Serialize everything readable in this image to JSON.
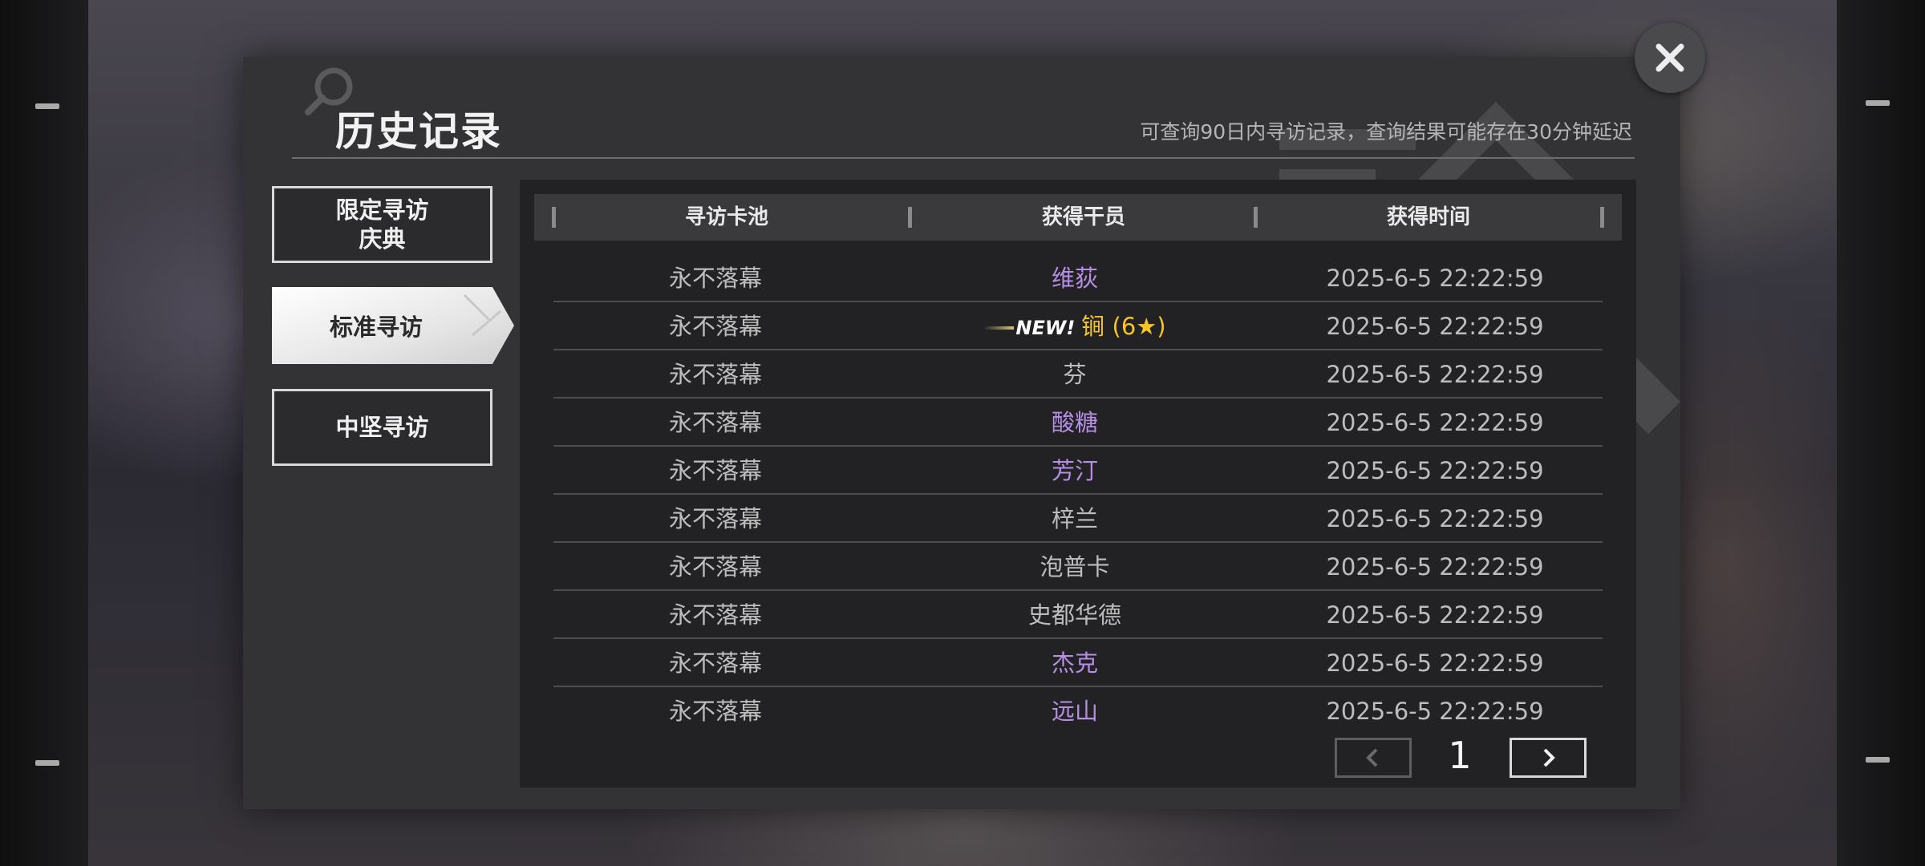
{
  "dialog": {
    "title": "历史记录",
    "subtitle": "可查询90日内寻访记录，查询结果可能存在30分钟延迟"
  },
  "tabs": [
    {
      "line1": "限定寻访",
      "line2": "庆典",
      "active": false
    },
    {
      "label": "标准寻访",
      "active": true
    },
    {
      "label": "中坚寻访",
      "active": false
    }
  ],
  "table": {
    "headers": [
      "寻访卡池",
      "获得干员",
      "获得时间"
    ],
    "rows": [
      {
        "pool": "永不落幕",
        "operator": "维荻",
        "time": "2025-6-5 22:22:59",
        "rarity_color": "#b78ee6"
      },
      {
        "pool": "永不落幕",
        "badge": "NEW!",
        "operator": "锏 (6★)",
        "time": "2025-6-5 22:22:59",
        "rarity_color": "#f5c526"
      },
      {
        "pool": "永不落幕",
        "operator": "芬",
        "time": "2025-6-5 22:22:59",
        "rarity_color": "#bdbdbd"
      },
      {
        "pool": "永不落幕",
        "operator": "酸糖",
        "time": "2025-6-5 22:22:59",
        "rarity_color": "#b78ee6"
      },
      {
        "pool": "永不落幕",
        "operator": "芳汀",
        "time": "2025-6-5 22:22:59",
        "rarity_color": "#b78ee6"
      },
      {
        "pool": "永不落幕",
        "operator": "梓兰",
        "time": "2025-6-5 22:22:59",
        "rarity_color": "#bdbdbd"
      },
      {
        "pool": "永不落幕",
        "operator": "泡普卡",
        "time": "2025-6-5 22:22:59",
        "rarity_color": "#bdbdbd"
      },
      {
        "pool": "永不落幕",
        "operator": "史都华德",
        "time": "2025-6-5 22:22:59",
        "rarity_color": "#bdbdbd"
      },
      {
        "pool": "永不落幕",
        "operator": "杰克",
        "time": "2025-6-5 22:22:59",
        "rarity_color": "#b78ee6"
      },
      {
        "pool": "永不落幕",
        "operator": "远山",
        "time": "2025-6-5 22:22:59",
        "rarity_color": "#b78ee6"
      }
    ]
  },
  "pagination": {
    "current_page": "1",
    "prev_icon": "chevron-left-icon",
    "next_icon": "chevron-right-icon"
  },
  "icons": {
    "close": "close-icon",
    "title_decoration": "magnifier-icon"
  },
  "colors": {
    "panel_bg": "#333335",
    "table_bg": "#222224",
    "six_star": "#f5c526",
    "five_star": "#b78ee6",
    "normal": "#bdbdbd"
  }
}
